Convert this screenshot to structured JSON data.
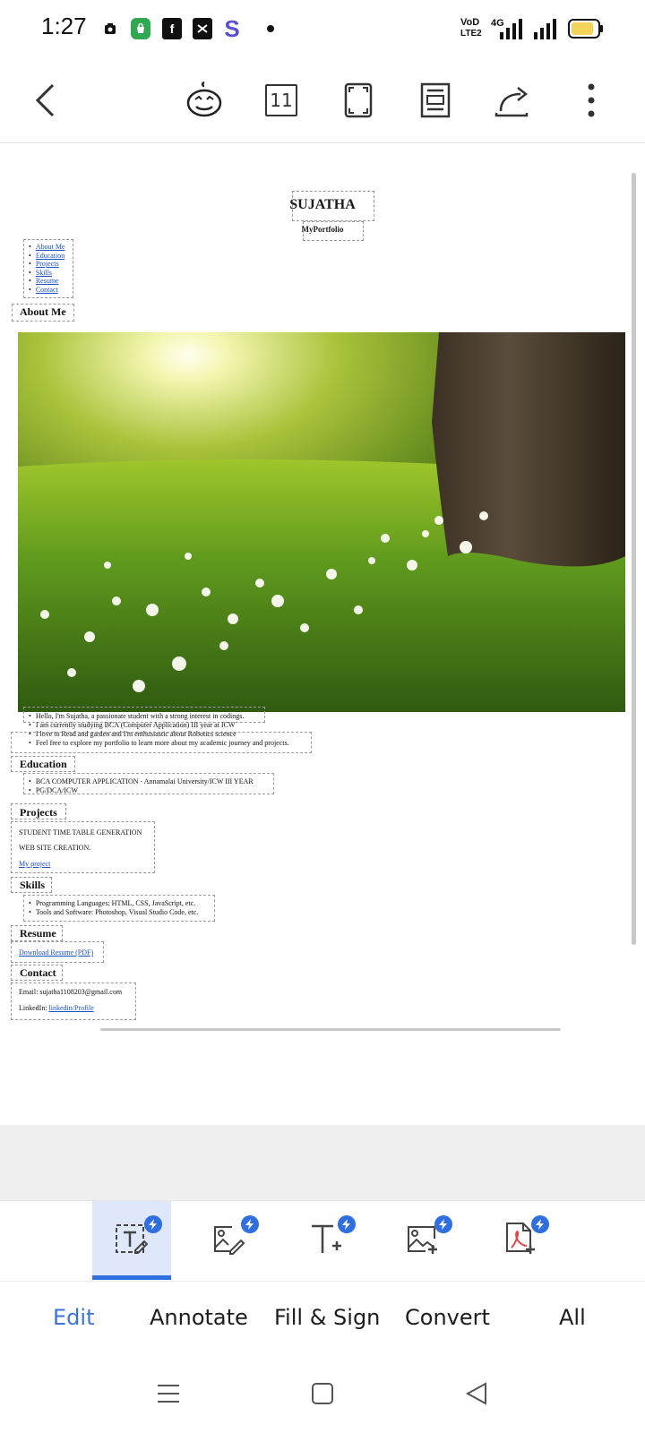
{
  "status_bar": {
    "time": "1:27",
    "network_label_top": "VoD",
    "network_label_bottom": "LTE2",
    "network_type": "4G",
    "icons": [
      "photo-icon",
      "shopping-icon",
      "facebook-icon",
      "capcut-icon",
      "s-app-icon",
      "dot-icon",
      "signal-icon",
      "battery-icon"
    ],
    "colors": {
      "shopping": "#2fa84f",
      "s_app": "#5a4fcf",
      "battery_fill": "#f3d35a"
    }
  },
  "toolbar": {
    "icons": [
      "back-arrow-icon",
      "pumpkin-icon",
      "page-count-icon",
      "fullscreen-icon",
      "reading-mode-icon",
      "share-icon",
      "more-icon"
    ],
    "page_count": "11"
  },
  "document": {
    "name": "SUJATHA",
    "subtitle": "MyPortfolio",
    "nav": [
      "About Me",
      "Education",
      "Projects",
      "Skills",
      "Resume",
      "Contact"
    ],
    "about": {
      "heading": "About Me",
      "image": "meadow-photo",
      "bullets": [
        "Hello, I'm Sujatha, a passionate student with a strong interest in codings.",
        "I am currently studying BCA (Computer Application) III year at ICW",
        "I love to Read and garden and I'm enthusiastic about Robotics science",
        "Feel free to explore my portfolio to learn more about my academic journey and projects."
      ]
    },
    "education": {
      "heading": "Education",
      "bullets": [
        "BCA COMPUTER APPLICATION - Annamalai University/ICW III YEAR",
        "PG/DCA/ICW"
      ]
    },
    "projects": {
      "heading": "Projects",
      "items": [
        "STUDENT TIME TABLE GENERATION",
        "WEB SITE CREATION."
      ],
      "link": "My project"
    },
    "skills": {
      "heading": "Skills",
      "bullets": [
        "Programming Languages: HTML, CSS, JavaScript, etc.",
        "Tools and Software: Photoshop, Visual Studio Code, etc."
      ]
    },
    "resume": {
      "heading": "Resume",
      "link": "Download Resume (PDF)"
    },
    "contact": {
      "heading": "Contact",
      "email": "Email: sujatha1108203@gmail.com",
      "linkedin_label": "LinkedIn: ",
      "linkedin_link": "linkedin/Profile"
    }
  },
  "actions": [
    {
      "label": "Edit",
      "icon": "edit-text-icon",
      "active": true
    },
    {
      "label": "Annotate",
      "icon": "annotate-image-icon",
      "active": false
    },
    {
      "label": "Fill & Sign",
      "icon": "add-text-icon",
      "active": false
    },
    {
      "label": "Convert",
      "icon": "add-image-icon",
      "active": false
    },
    {
      "label": "All",
      "icon": "pdf-add-icon",
      "active": false
    }
  ],
  "accent_color": "#2f6fe0",
  "nav_bar": {
    "icons": [
      "menu-icon",
      "home-icon",
      "back-icon"
    ]
  }
}
